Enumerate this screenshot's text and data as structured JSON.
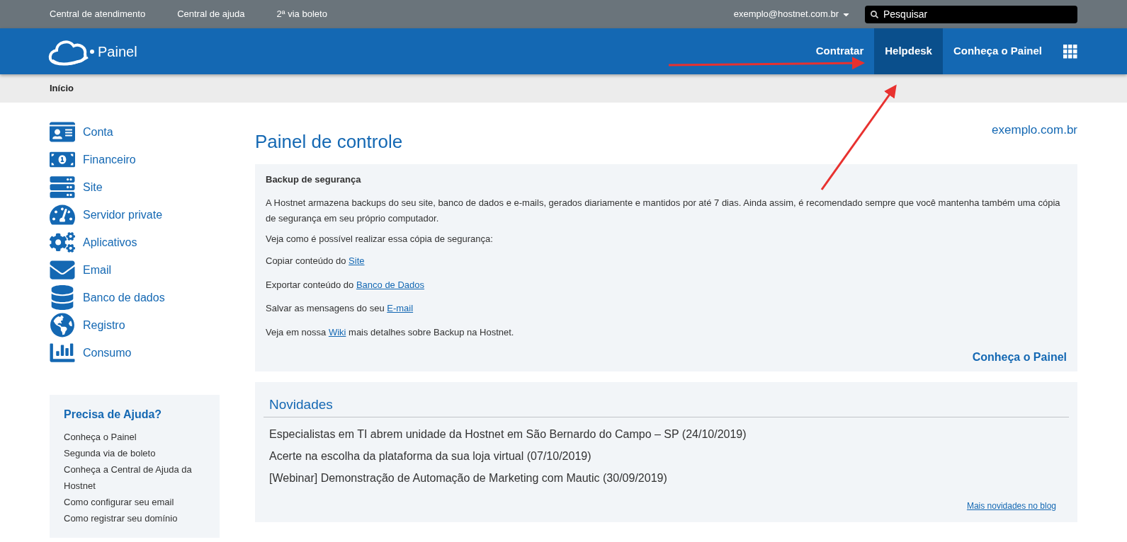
{
  "top_bar": {
    "links": [
      "Central de atendimento",
      "Central de ajuda",
      "2ª via boleto"
    ],
    "account": "exemplo@hostnet.com.br",
    "search": {
      "placeholder": "Pesquisar"
    }
  },
  "nav": {
    "brand": "Painel",
    "items": [
      {
        "label": "Contratar",
        "selected": false
      },
      {
        "label": "Helpdesk",
        "selected": true
      },
      {
        "label": "Conheça o Painel",
        "selected": false
      }
    ]
  },
  "breadcrumb": "Início",
  "sidebar": {
    "items": [
      "Conta",
      "Financeiro",
      "Site",
      "Servidor private",
      "Aplicativos",
      "Email",
      "Banco de dados",
      "Registro",
      "Consumo"
    ],
    "help": {
      "title": "Precisa de Ajuda?",
      "links": [
        "Conheça o Painel",
        "Segunda via de boleto",
        "Conheça a Central de Ajuda da Hostnet",
        "Como configurar seu email",
        "Como registrar seu domínio"
      ]
    }
  },
  "main": {
    "title": "Painel de controle",
    "domain": "exemplo.com.br",
    "backup": {
      "title": "Backup de segurança",
      "intro": "A Hostnet armazena backups do seu site, banco de dados e e-mails, gerados diariamente e mantidos por até 7 dias. Ainda assim, é recomendado sempre que você mantenha também uma cópia de segurança em seu próprio computador.",
      "lead": "Veja como é possível realizar essa cópia de segurança:",
      "lines": [
        {
          "before": "Copiar conteúdo do ",
          "link": "Site"
        },
        {
          "before": "Exportar conteúdo do ",
          "link": "Banco de Dados"
        },
        {
          "before": "Salvar as mensagens do seu ",
          "link": "E-mail"
        },
        {
          "before": "Veja em nossa ",
          "link": "Wiki",
          "after": " mais detalhes sobre Backup na Hostnet."
        }
      ],
      "action": "Conheça o Painel"
    },
    "news": {
      "title": "Novidades",
      "items": [
        "Especialistas em TI abrem unidade da Hostnet em São Bernardo do Campo – SP (24/10/2019)",
        "Acerte na escolha da plataforma da sua loja virtual (07/10/2019)",
        "[Webinar] Demonstração de Automação de Marketing com Mautic (30/09/2019)"
      ],
      "more": "Mais novidades no blog"
    }
  }
}
